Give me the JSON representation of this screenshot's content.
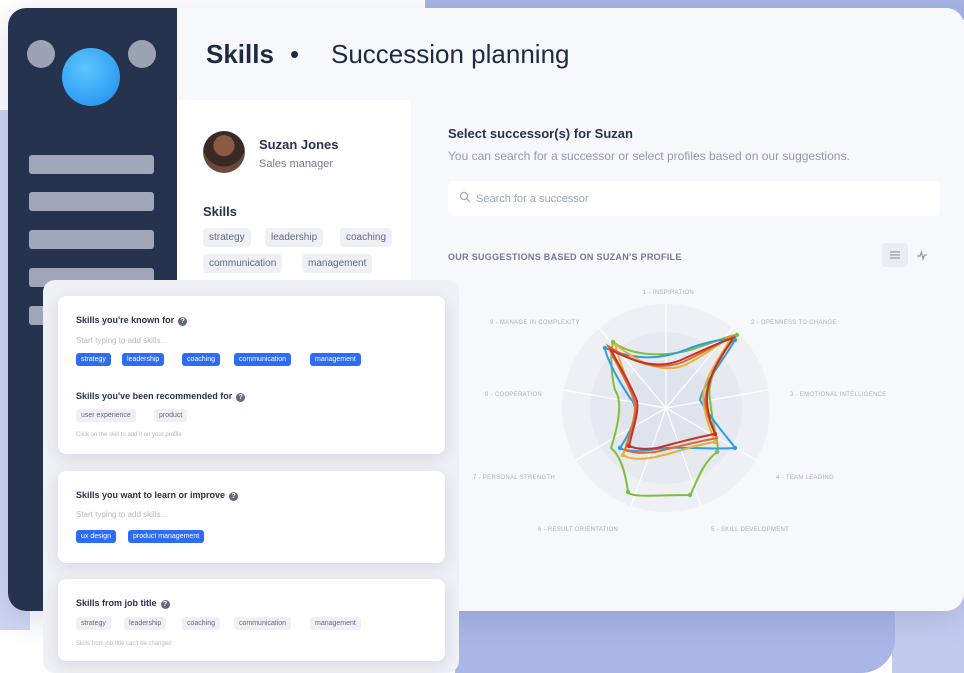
{
  "header": {
    "title": "Skills",
    "separator": "•",
    "subtitle": "Succession planning"
  },
  "profile": {
    "name": "Suzan Jones",
    "role": "Sales manager",
    "skills_heading": "Skills",
    "skills": [
      "strategy",
      "leadership",
      "coaching",
      "communication",
      "management"
    ]
  },
  "successor": {
    "title": "Select successor(s) for Suzan",
    "subtitle": "You can search for a successor or select profiles based on our suggestions.",
    "search_placeholder": "Search for a successor",
    "suggestions_title": "OUR SUGGESTIONS BASED ON SUZAN'S PROFILE"
  },
  "radar": {
    "axes": [
      "1 - INSPIRATION",
      "2 - OPENNESS TO CHANGE",
      "3 - EMOTIONAL INTELLIGENCE",
      "4 - TEAM LEADING",
      "5 - SKILL DEVELOPMENT",
      "6 - RESULT ORIENTATION",
      "7 - PERSONAL STRENGTH",
      "8 - COOPERATION",
      "9 - MANAGE IN COMPLEXITY"
    ],
    "series_colors": [
      "#2f9be0",
      "#7fbf3a",
      "#e2b23a",
      "#e06a2a",
      "#c4302b"
    ]
  },
  "cards": {
    "known": {
      "title": "Skills you're known for",
      "hint": "Start typing to add skills...",
      "skills": [
        "strategy",
        "leadership",
        "coaching",
        "communication",
        "management"
      ]
    },
    "recommended": {
      "title": "Skills you've been recommended for",
      "skills": [
        "user experience",
        "product"
      ],
      "note": "Click on the skill to add it on your profile"
    },
    "learn": {
      "title": "Skills you want to learn or improve",
      "hint": "Start typing to add skills...",
      "skills": [
        "ux design",
        "product management"
      ]
    },
    "job": {
      "title": "Skills from job title",
      "skills": [
        "strategy",
        "leadership",
        "coaching",
        "communication",
        "management"
      ],
      "note": "Skills from job title can't be changed"
    }
  },
  "colors": {
    "sidebar": "#26334f",
    "accent": "#2f6cf6",
    "avatar": "#1e8cf0"
  }
}
